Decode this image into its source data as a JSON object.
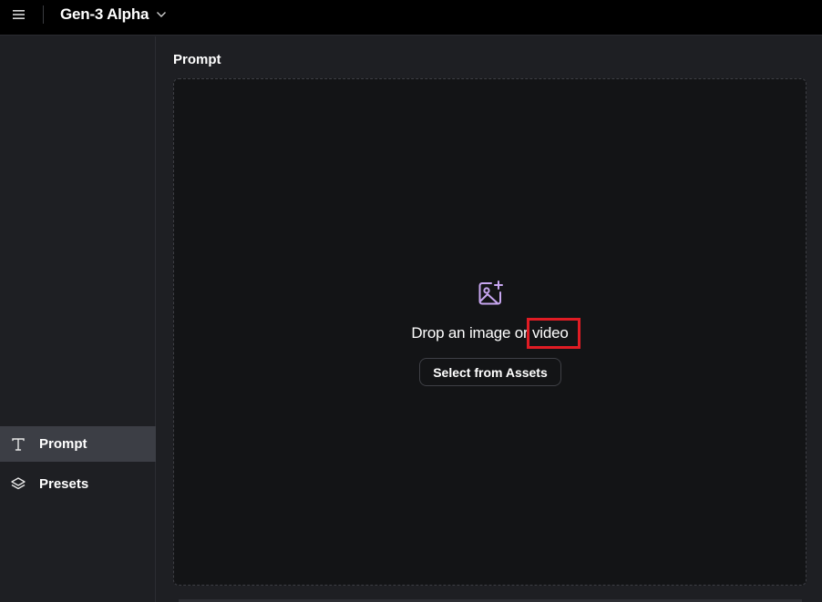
{
  "header": {
    "model_name": "Gen-3 Alpha",
    "menu_icon": "hamburger-menu-icon",
    "dropdown_icon": "chevron-down-icon"
  },
  "sidebar": {
    "items": [
      {
        "label": "Prompt",
        "icon": "text-t-icon",
        "active": true
      },
      {
        "label": "Presets",
        "icon": "layers-icon",
        "active": false
      }
    ]
  },
  "main": {
    "section_label": "Prompt",
    "dropzone": {
      "icon": "image-add-icon",
      "text": "Drop an image or video",
      "select_button_label": "Select from Assets"
    }
  },
  "colors": {
    "background": "#1e1f23",
    "topbar": "#000000",
    "dropzone": "#131416",
    "active_item": "#3c3e45",
    "accent_icon": "#c7a6f0",
    "highlight": "#e01c24"
  }
}
